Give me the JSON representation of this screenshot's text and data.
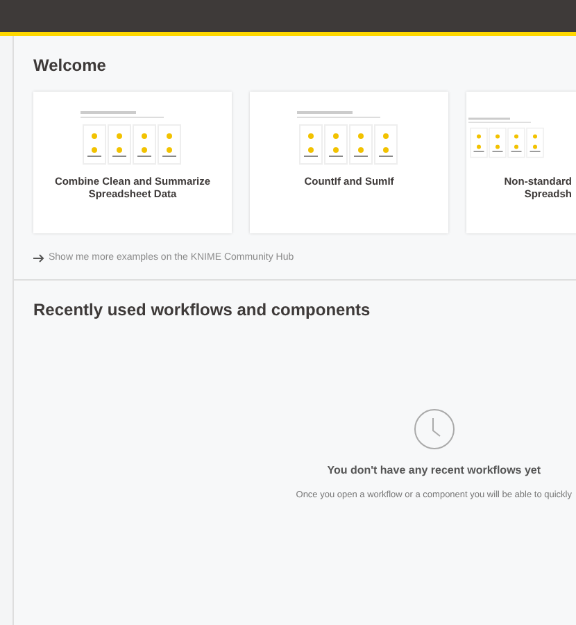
{
  "welcome": {
    "title": "Welcome",
    "cards": [
      {
        "title": "Combine Clean and Summarize Spreadsheet Data",
        "clipped": false
      },
      {
        "title": "CountIf and SumIf",
        "clipped": false
      },
      {
        "title": "Non-standard Spreadsh",
        "clipped": true
      }
    ],
    "link": "Show me more examples on the KNIME Community Hub"
  },
  "recent": {
    "title": "Recently used workflows and components",
    "empty_title": "You don't have any recent workflows yet",
    "empty_text": "Once you open a workflow or a component you will be able to quickly"
  }
}
